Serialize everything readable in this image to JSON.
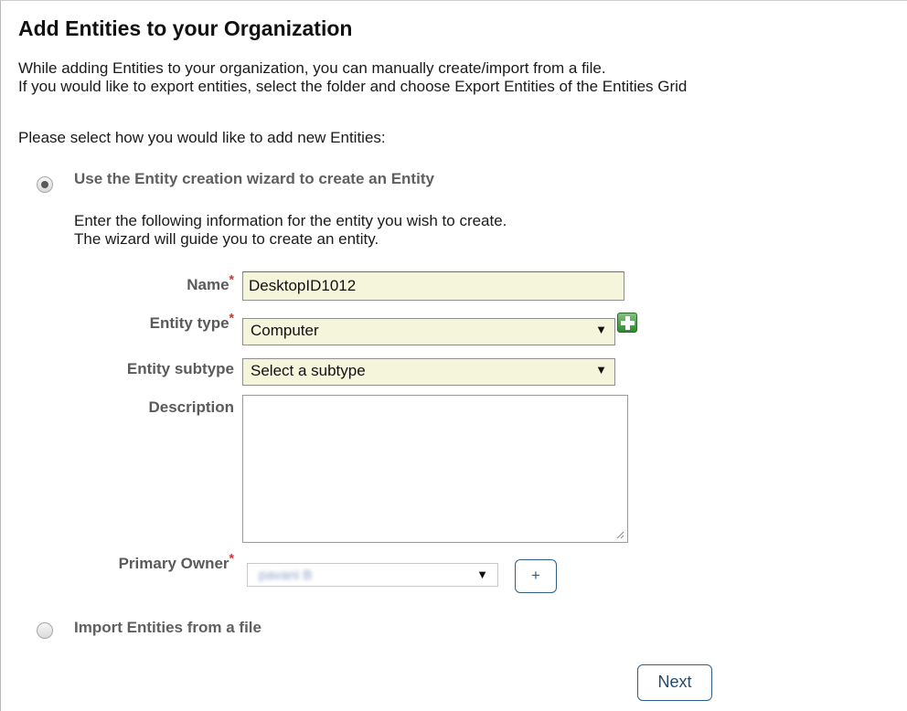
{
  "page": {
    "title": "Add Entities to your Organization",
    "intro_line1": "While adding Entities to your organization, you can manually create/import from a file.",
    "intro_line2": "If you would like to export entities, select the folder and choose Export Entities of the Entities Grid",
    "prompt": "Please select how you would like to add new Entities:"
  },
  "options": {
    "wizard": {
      "label": "Use the Entity creation wizard to create an Entity",
      "checked": true
    },
    "import": {
      "label": "Import Entities from a file",
      "checked": false
    }
  },
  "wizard": {
    "instruction_line1": "Enter the following information for the entity you wish to create.",
    "instruction_line2": "The wizard will guide you to create an entity.",
    "required_marker": "*",
    "name": {
      "label": "Name",
      "value": "DesktopID1012"
    },
    "entity_type": {
      "label": "Entity type",
      "selected": "Computer",
      "add_icon": "plus-square-icon"
    },
    "entity_subtype": {
      "label": "Entity subtype",
      "selected": "Select a subtype"
    },
    "description": {
      "label": "Description",
      "value": ""
    },
    "primary_owner": {
      "label": "Primary Owner",
      "selected": "pavani B",
      "add_button": "+"
    }
  },
  "actions": {
    "next": "Next"
  },
  "icons": {
    "dropdown": "▼"
  },
  "colors": {
    "field_bg": "#f5f5dc",
    "required": "#d32f2f",
    "button_border": "#2e5f86",
    "add_icon": "#3a9a3a"
  }
}
